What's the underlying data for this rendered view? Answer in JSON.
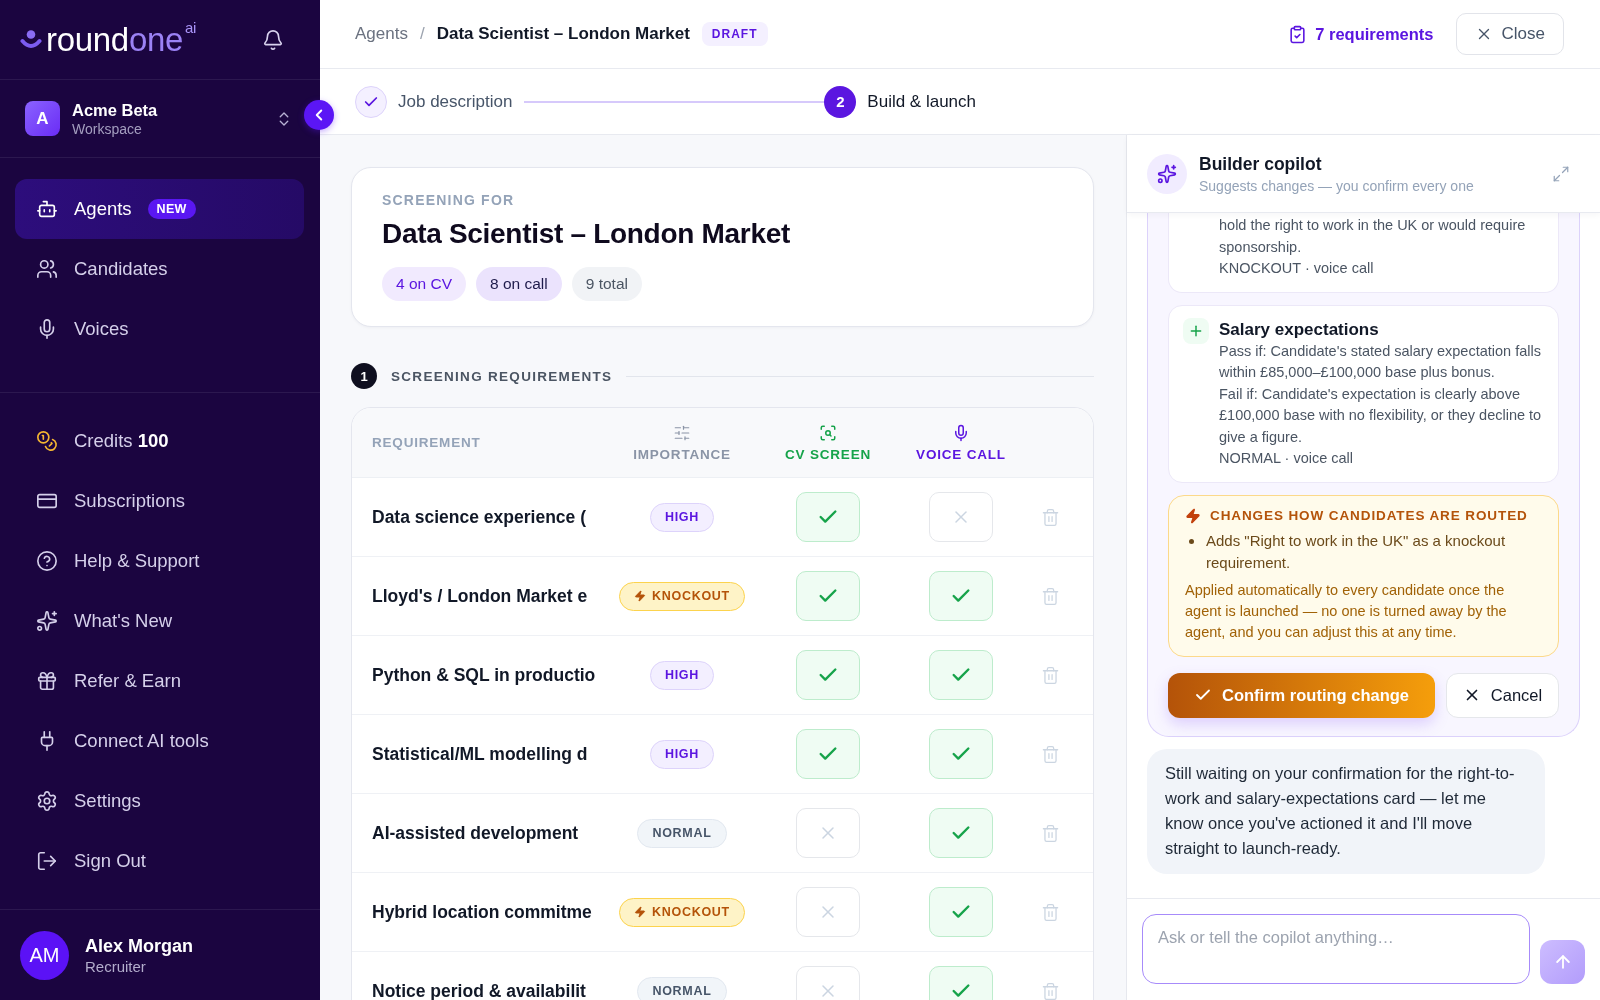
{
  "sidebar": {
    "logo": {
      "word": "round",
      "accent": "one",
      "superscript": "ai"
    },
    "workspace": {
      "initial": "A",
      "name": "Acme Beta",
      "label": "Workspace"
    },
    "nav": [
      {
        "label": "Agents",
        "badge": "NEW",
        "selected": true
      },
      {
        "label": "Candidates",
        "selected": false
      },
      {
        "label": "Voices",
        "selected": false
      }
    ],
    "nav_secondary": [
      {
        "label": "Credits **100**",
        "selected": false
      },
      {
        "label": "Subscriptions",
        "selected": false
      },
      {
        "label": "Help & Support",
        "selected": false
      },
      {
        "label": "What's New",
        "selected": false
      },
      {
        "label": "Refer & Earn",
        "selected": false
      },
      {
        "label": "Connect AI tools",
        "selected": false
      },
      {
        "label": "Settings",
        "selected": false
      },
      {
        "label": "Sign Out",
        "selected": false
      }
    ],
    "user": {
      "initials": "AM",
      "name": "Alex Morgan",
      "role": "Recruiter"
    }
  },
  "breadcrumb": {
    "parent": "Agents",
    "separator": "/",
    "current": "Data Scientist – London Market",
    "status": "DRAFT"
  },
  "header_actions": {
    "requirements_link": "7 requirements",
    "close_button": "Close"
  },
  "stepper": [
    {
      "label": "Job description",
      "done": true,
      "selected": false
    },
    {
      "label": "Build & launch",
      "number": "2",
      "done": false,
      "selected": true
    }
  ],
  "screening_card": {
    "eyebrow": "SCREENING FOR",
    "title": "Data Scientist – London Market",
    "chips": [
      {
        "label": "4 on CV",
        "kind": "cv"
      },
      {
        "label": "8 on call",
        "kind": "call"
      },
      {
        "label": "9 total",
        "kind": "total"
      }
    ]
  },
  "section": {
    "number": "1",
    "title": "SCREENING REQUIREMENTS"
  },
  "requirements": {
    "columns": [
      {
        "label": "REQUIREMENT",
        "kind": "text"
      },
      {
        "label": "IMPORTANCE",
        "kind": "importance"
      },
      {
        "label": "CV SCREEN",
        "kind": "cv"
      },
      {
        "label": "VOICE CALL",
        "kind": "voice"
      }
    ],
    "rows": [
      {
        "name": "Data science experience (",
        "importance": {
          "label": "HIGH",
          "kind": "high"
        },
        "cv_checked": true,
        "voice_checked": false
      },
      {
        "name": "Lloyd's / London Market e",
        "importance": {
          "label": "KNOCKOUT",
          "kind": "knockout"
        },
        "cv_checked": true,
        "voice_checked": true
      },
      {
        "name": "Python & SQL in productio",
        "importance": {
          "label": "HIGH",
          "kind": "high"
        },
        "cv_checked": true,
        "voice_checked": true
      },
      {
        "name": "Statistical/ML modelling d",
        "importance": {
          "label": "HIGH",
          "kind": "high"
        },
        "cv_checked": true,
        "voice_checked": true
      },
      {
        "name": "AI-assisted development",
        "importance": {
          "label": "NORMAL",
          "kind": "normal"
        },
        "cv_checked": false,
        "voice_checked": true
      },
      {
        "name": "Hybrid location commitme",
        "importance": {
          "label": "KNOCKOUT",
          "kind": "knockout"
        },
        "cv_checked": false,
        "voice_checked": true
      },
      {
        "name": "Notice period & availabilit",
        "importance": {
          "label": "NORMAL",
          "kind": "normal"
        },
        "cv_checked": false,
        "voice_checked": true
      }
    ]
  },
  "copilot": {
    "title": "Builder copilot",
    "subtitle": "Suggests changes — you confirm every one",
    "proposal": {
      "cards": [
        {
          "kind": "continued",
          "lines": [
            "hold the right to work in the UK or would require sponsorship."
          ],
          "tag": "KNOCKOUT · voice call"
        },
        {
          "kind": "added",
          "title": "Salary expectations",
          "lines": [
            "Pass if: Candidate's stated salary expectation falls within £85,000–£100,000 base plus bonus.",
            "Fail if: Candidate's expectation is clearly above £100,000 base with no flexibility, or they decline to give a figure."
          ],
          "tag": "NORMAL · voice call"
        }
      ],
      "notice": {
        "title": "CHANGES HOW CANDIDATES ARE ROUTED",
        "bullets": [
          "Adds \"Right to work in the UK\" as a knockout requirement."
        ],
        "note": "Applied automatically to every candidate once the agent is launched — no one is turned away by the agent, and you can adjust this at any time."
      },
      "confirm_button": "Confirm routing change",
      "cancel_button": "Cancel"
    },
    "messages": [
      {
        "text": "Still waiting on your confirmation for the right-to-work and salary-expectations card — let me know once you've actioned it and I'll move straight to launch-ready."
      }
    ],
    "input": {
      "placeholder": "Ask or tell the copilot anything…"
    },
    "send_button": {
      "disabled": true
    }
  }
}
